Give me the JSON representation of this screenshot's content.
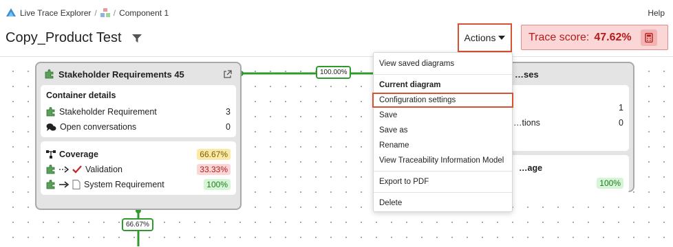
{
  "breadcrumb": {
    "app": "Live Trace Explorer",
    "component": "Component 1"
  },
  "help": "Help",
  "page_title": "Copy_Product Test",
  "actions_label": "Actions",
  "trace": {
    "label": "Trace score:",
    "value": "47.62%"
  },
  "left_card": {
    "title": "Stakeholder Requirements 45",
    "container": {
      "title": "Container details",
      "rows": [
        {
          "label": "Stakeholder Requirement",
          "value": "3"
        },
        {
          "label": "Open conversations",
          "value": "0"
        }
      ]
    },
    "coverage": {
      "title": "Coverage",
      "value": "66.67%",
      "rows": [
        {
          "label": "Validation",
          "value": "33.33%"
        },
        {
          "label": "System Requirement",
          "value": "100%"
        }
      ]
    }
  },
  "right_card": {
    "title": "…ses",
    "rows": [
      {
        "label": "",
        "value": "1"
      },
      {
        "label": "…tions",
        "value": "0"
      }
    ],
    "coverage_title": "…age",
    "coverage_value": "100%"
  },
  "edges": {
    "horizontal": "100.00%",
    "vertical": "66.67%"
  },
  "menu": {
    "items": [
      "View saved diagrams",
      "Current diagram",
      "Configuration settings",
      "Save",
      "Save as",
      "Rename",
      "View Traceability Information Model",
      "Export to PDF",
      "Delete"
    ]
  },
  "colors": {
    "accent_border": "#d9502e",
    "edge": "#2e9a2e",
    "trace_bg": "#fbd6d6"
  }
}
